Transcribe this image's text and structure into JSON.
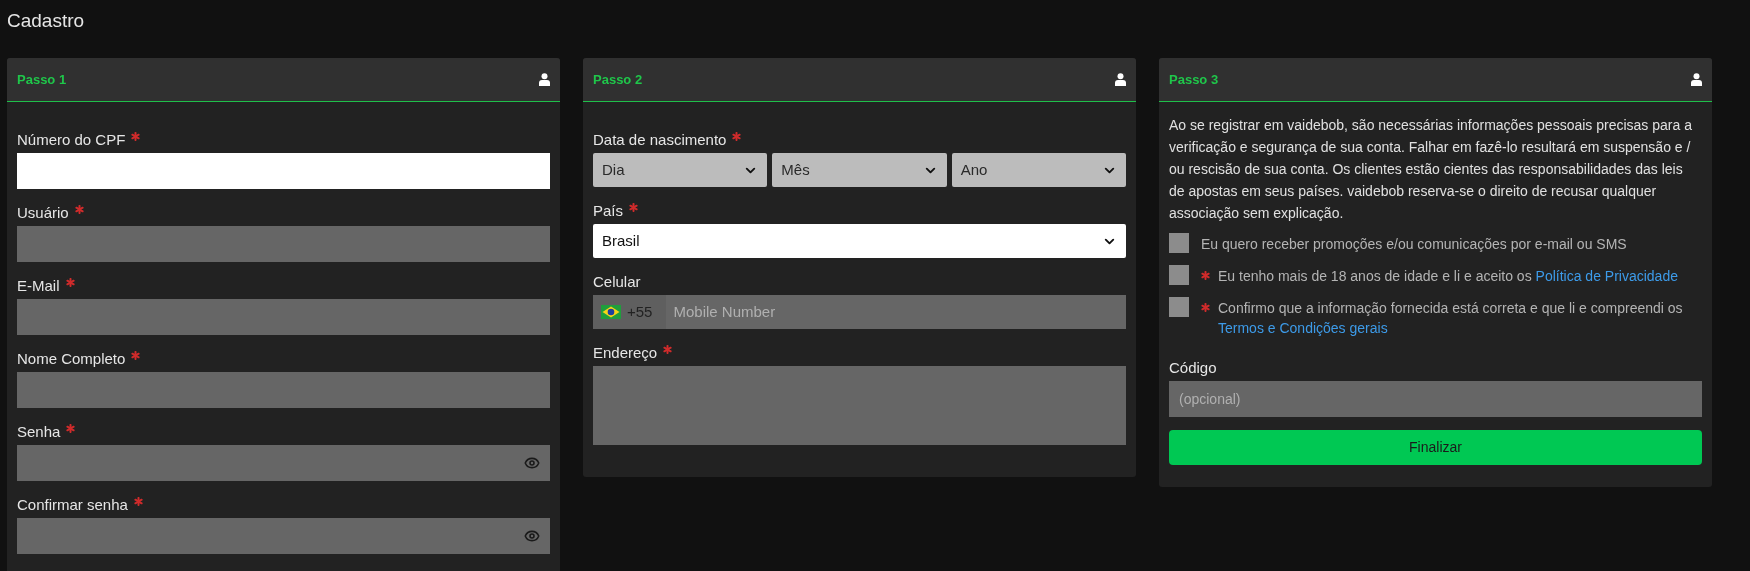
{
  "page_title": "Cadastro",
  "steps": [
    {
      "title": "Passo 1",
      "fields": [
        {
          "kind": "text",
          "label": "Número do CPF",
          "required": true,
          "focused": true
        },
        {
          "kind": "text",
          "label": "Usuário",
          "required": true,
          "focused": false
        },
        {
          "kind": "text",
          "label": "E-Mail",
          "required": true,
          "focused": false
        },
        {
          "kind": "text",
          "label": "Nome Completo",
          "required": true,
          "focused": false
        },
        {
          "kind": "password",
          "label": "Senha",
          "required": true,
          "focused": false
        },
        {
          "kind": "password",
          "label": "Confirmar senha",
          "required": true,
          "focused": false
        }
      ]
    },
    {
      "title": "Passo 2",
      "fields": [
        {
          "kind": "date",
          "label": "Data de nascimento",
          "required": true,
          "selects": [
            "Dia",
            "Mês",
            "Ano"
          ]
        },
        {
          "kind": "select",
          "label": "País",
          "required": true,
          "value": "Brasil",
          "focused": true
        },
        {
          "kind": "phone",
          "label": "Celular",
          "required": false,
          "code": "+55",
          "placeholder": "Mobile Number"
        },
        {
          "kind": "textarea",
          "label": "Endereço",
          "required": true,
          "focused": false
        }
      ]
    },
    {
      "title": "Passo 3",
      "notice": "Ao se registrar em vaidebob, são necessárias informações pessoais precisas para a verificação e segurança de sua conta. Falhar em fazê-lo resultará em suspensão e / ou rescisão de sua conta. Os clientes estão cientes das responsabilidades das leis de apostas em seus países. vaidebob reserva-se o direito de recusar qualquer associação sem explicação.",
      "checkboxes": [
        {
          "text": "Eu quero receber promoções e/ou comunicações por e-mail ou SMS",
          "required": false,
          "checked": false
        },
        {
          "text": "Eu tenho mais de 18 anos de idade e li e aceito os",
          "link": "Política de Privacidade",
          "required": true,
          "checked": false
        },
        {
          "text": "Confirmo que a informação fornecida está correta e que li e compreendi os",
          "link": "Termos e Condições gerais",
          "required": true,
          "checked": false
        }
      ],
      "fields": [
        {
          "kind": "text",
          "label": "Código",
          "required": false,
          "focused": false,
          "placeholder": "(opcional)"
        }
      ],
      "submit": "Finalizar"
    }
  ]
}
